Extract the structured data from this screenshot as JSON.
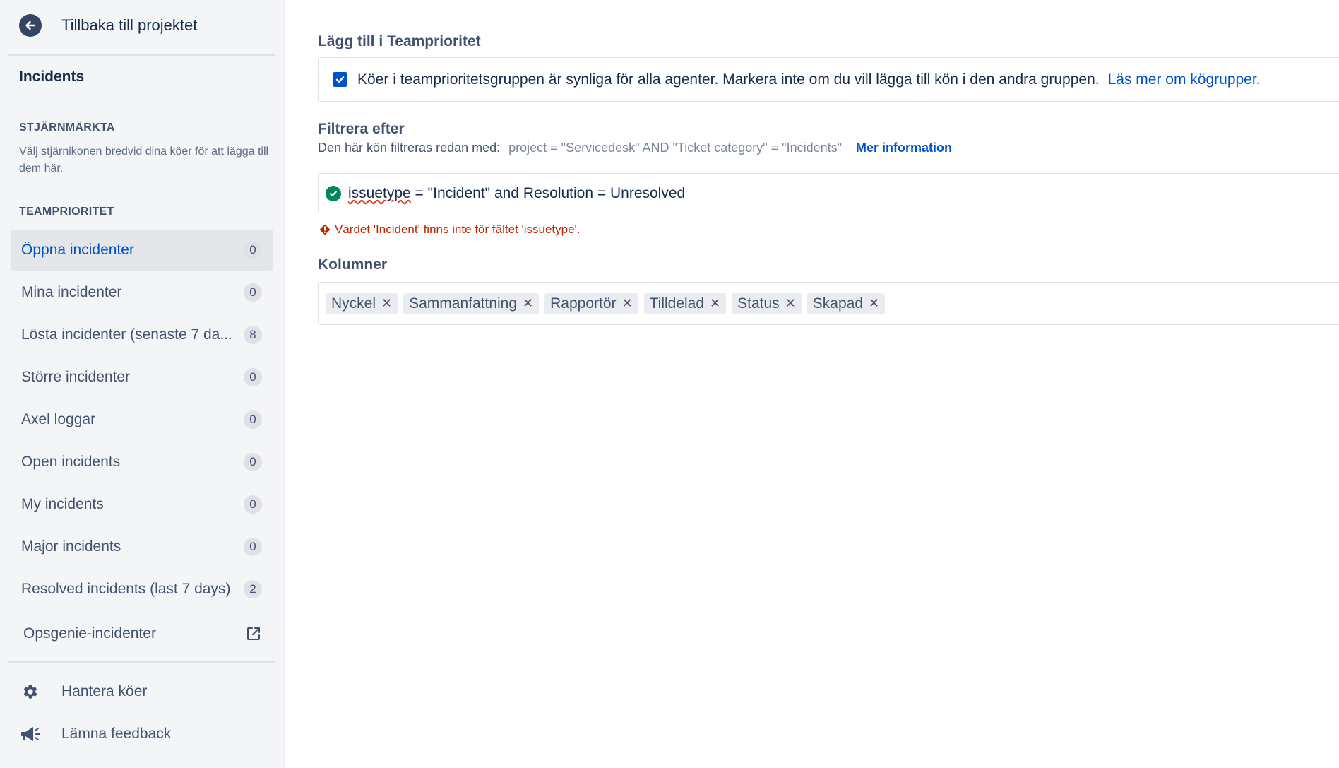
{
  "sidebar": {
    "back_label": "Tillbaka till projektet",
    "project_name": "Incidents",
    "starred_heading": "STJÄRNMÄRKTA",
    "starred_hint": "Välj stjärnikonen bredvid dina köer för att lägga till dem här.",
    "team_heading": "TEAMPRIORITET",
    "queues": [
      {
        "label": "Öppna incidenter",
        "count": "0"
      },
      {
        "label": "Mina incidenter",
        "count": "0"
      },
      {
        "label": "Lösta incidenter (senaste 7 da...",
        "count": "8"
      },
      {
        "label": "Större incidenter",
        "count": "0"
      },
      {
        "label": "Axel loggar",
        "count": "0"
      },
      {
        "label": "Open incidents",
        "count": "0"
      },
      {
        "label": "My incidents",
        "count": "0"
      },
      {
        "label": "Major incidents",
        "count": "0"
      },
      {
        "label": "Resolved incidents (last 7 days)",
        "count": "2"
      }
    ],
    "external_link_label": "Opsgenie-incidenter",
    "manage_label": "Hantera köer",
    "feedback_label": "Lämna feedback"
  },
  "main": {
    "team_priority_heading": "Lägg till i Teamprioritet",
    "team_priority_checkbox_text": "Köer i teamprioritetsgruppen är synliga för alla agenter. Markera inte om du vill lägga till kön i den andra gruppen.",
    "team_priority_link": "Läs mer om kögrupper.",
    "filter_heading": "Filtrera efter",
    "filter_desc": "Den här kön filtreras redan med:",
    "filter_existing": "project = \"Servicedesk\" AND \"Ticket category\" = \"Incidents\"",
    "filter_more": "Mer information",
    "jql_field": "issuetype",
    "jql_rest": " = \"Incident\" and Resolution = Unresolved",
    "error_text": "Värdet 'Incident' finns inte för fältet 'issuetype'.",
    "columns_heading": "Kolumner",
    "columns": [
      "Nyckel",
      "Sammanfattning",
      "Rapportör",
      "Tilldelad",
      "Status",
      "Skapad"
    ]
  },
  "colors": {
    "accent": "#0052cc",
    "success": "#00875a",
    "error": "#bf2600"
  }
}
